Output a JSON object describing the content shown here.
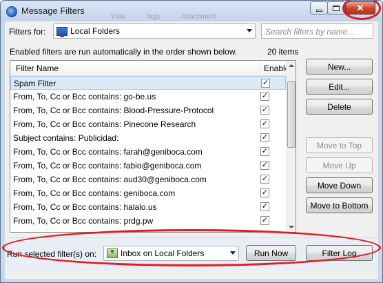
{
  "window": {
    "title": "Message Filters",
    "background_ghost_texts": [
      "View",
      "Tags",
      "Attachment"
    ]
  },
  "toolbar": {
    "filters_for_label": "Filters for:",
    "account_selected": "Local Folders",
    "search_placeholder": "Search filters by name..."
  },
  "info": {
    "description": "Enabled filters are run automatically in the order shown below.",
    "count": "20 items"
  },
  "list": {
    "header_name": "Filter Name",
    "header_enabled": "Enabled",
    "rows": [
      {
        "name": "Spam Filter",
        "enabled": "✓"
      },
      {
        "name": "From, To, Cc or Bcc contains: go-be.us",
        "enabled": "✓"
      },
      {
        "name": "From, To, Cc or Bcc contains: Blood-Pressure-Protocol",
        "enabled": "✓"
      },
      {
        "name": "From, To, Cc or Bcc contains: Pinecone Research",
        "enabled": "✓"
      },
      {
        "name": "Subject contains: Publicidad:",
        "enabled": "✓"
      },
      {
        "name": "From, To, Cc or Bcc contains: farah@geniboca.com",
        "enabled": "✓"
      },
      {
        "name": "From, To, Cc or Bcc contains: fabio@geniboca.com",
        "enabled": "✓"
      },
      {
        "name": "From, To, Cc or Bcc contains: aud30@geniboca.com",
        "enabled": "✓"
      },
      {
        "name": "From, To, Cc or Bcc contains: geniboca.com",
        "enabled": "✓"
      },
      {
        "name": "From, To, Cc or Bcc contains: halalo.us",
        "enabled": "✓"
      },
      {
        "name": "From, To, Cc or Bcc contains: prdg.pw",
        "enabled": "✓"
      }
    ]
  },
  "buttons": {
    "new": "New...",
    "edit": "Edit...",
    "delete": "Delete",
    "move_to_top": "Move to Top",
    "move_up": "Move Up",
    "move_down": "Move Down",
    "move_to_bottom": "Move to Bottom"
  },
  "bottom": {
    "run_label": "Run selected filter(s) on:",
    "run_folder": "Inbox on Local Folders",
    "run_now": "Run Now",
    "filter_log": "Filter Log"
  },
  "colors": {
    "annotation_red": "#e01b24",
    "selection": "#dceaf8",
    "titlebar": "#c9d8ea"
  }
}
